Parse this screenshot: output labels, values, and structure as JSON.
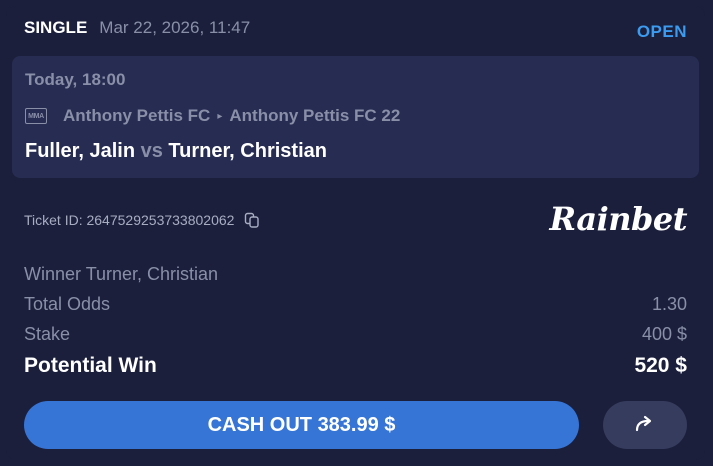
{
  "header": {
    "type": "SINGLE",
    "date": "Mar 22, 2026, 11:47",
    "status": "OPEN"
  },
  "event": {
    "time": "Today, 18:00",
    "sport_badge": "MMA",
    "league": "Anthony Pettis FC",
    "sub_league": "Anthony Pettis FC 22",
    "home": "Fuller, Jalin",
    "vs": "vs",
    "away": "Turner, Christian"
  },
  "ticket": {
    "label": "Ticket ID: 2647529253733802062"
  },
  "brand": "Rainbet",
  "selection": "Winner Turner, Christian",
  "summary": {
    "odds_label": "Total Odds",
    "odds_value": "1.30",
    "stake_label": "Stake",
    "stake_value": "400 $",
    "win_label": "Potential Win",
    "win_value": "520 $"
  },
  "actions": {
    "cashout_label": "CASH OUT 383.99 $",
    "share_icon": "share-arrow-icon"
  },
  "colors": {
    "background": "#1b1f3b",
    "panel": "#262c52",
    "accent": "#3675d6",
    "status": "#3b9bf0"
  }
}
